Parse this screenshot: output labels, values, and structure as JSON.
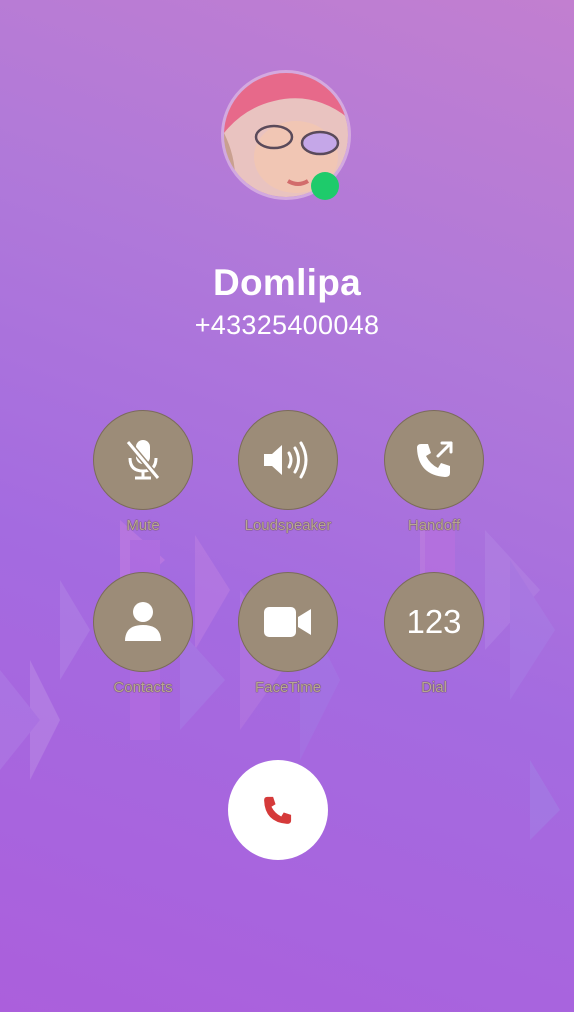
{
  "caller": {
    "name": "Domlipa",
    "number": "+43325400048",
    "presence_color": "#1ecb6b"
  },
  "controls": {
    "mute": {
      "label": "Mute",
      "icon": "mic-off-icon"
    },
    "loudspeaker": {
      "label": "Loudspeaker",
      "icon": "speaker-icon"
    },
    "handoff": {
      "label": "Handoff",
      "icon": "phone-forward-icon"
    },
    "contacts": {
      "label": "Contacts",
      "icon": "person-icon"
    },
    "facetime": {
      "label": "FaceTime",
      "icon": "video-camera-icon"
    },
    "dial": {
      "label": "Dial",
      "icon_text": "123"
    }
  },
  "end_call": {
    "icon": "phone-end-icon",
    "color": "#d53a3a"
  },
  "colors": {
    "button_fill": "#9c8c78",
    "label": "#b9a792"
  }
}
